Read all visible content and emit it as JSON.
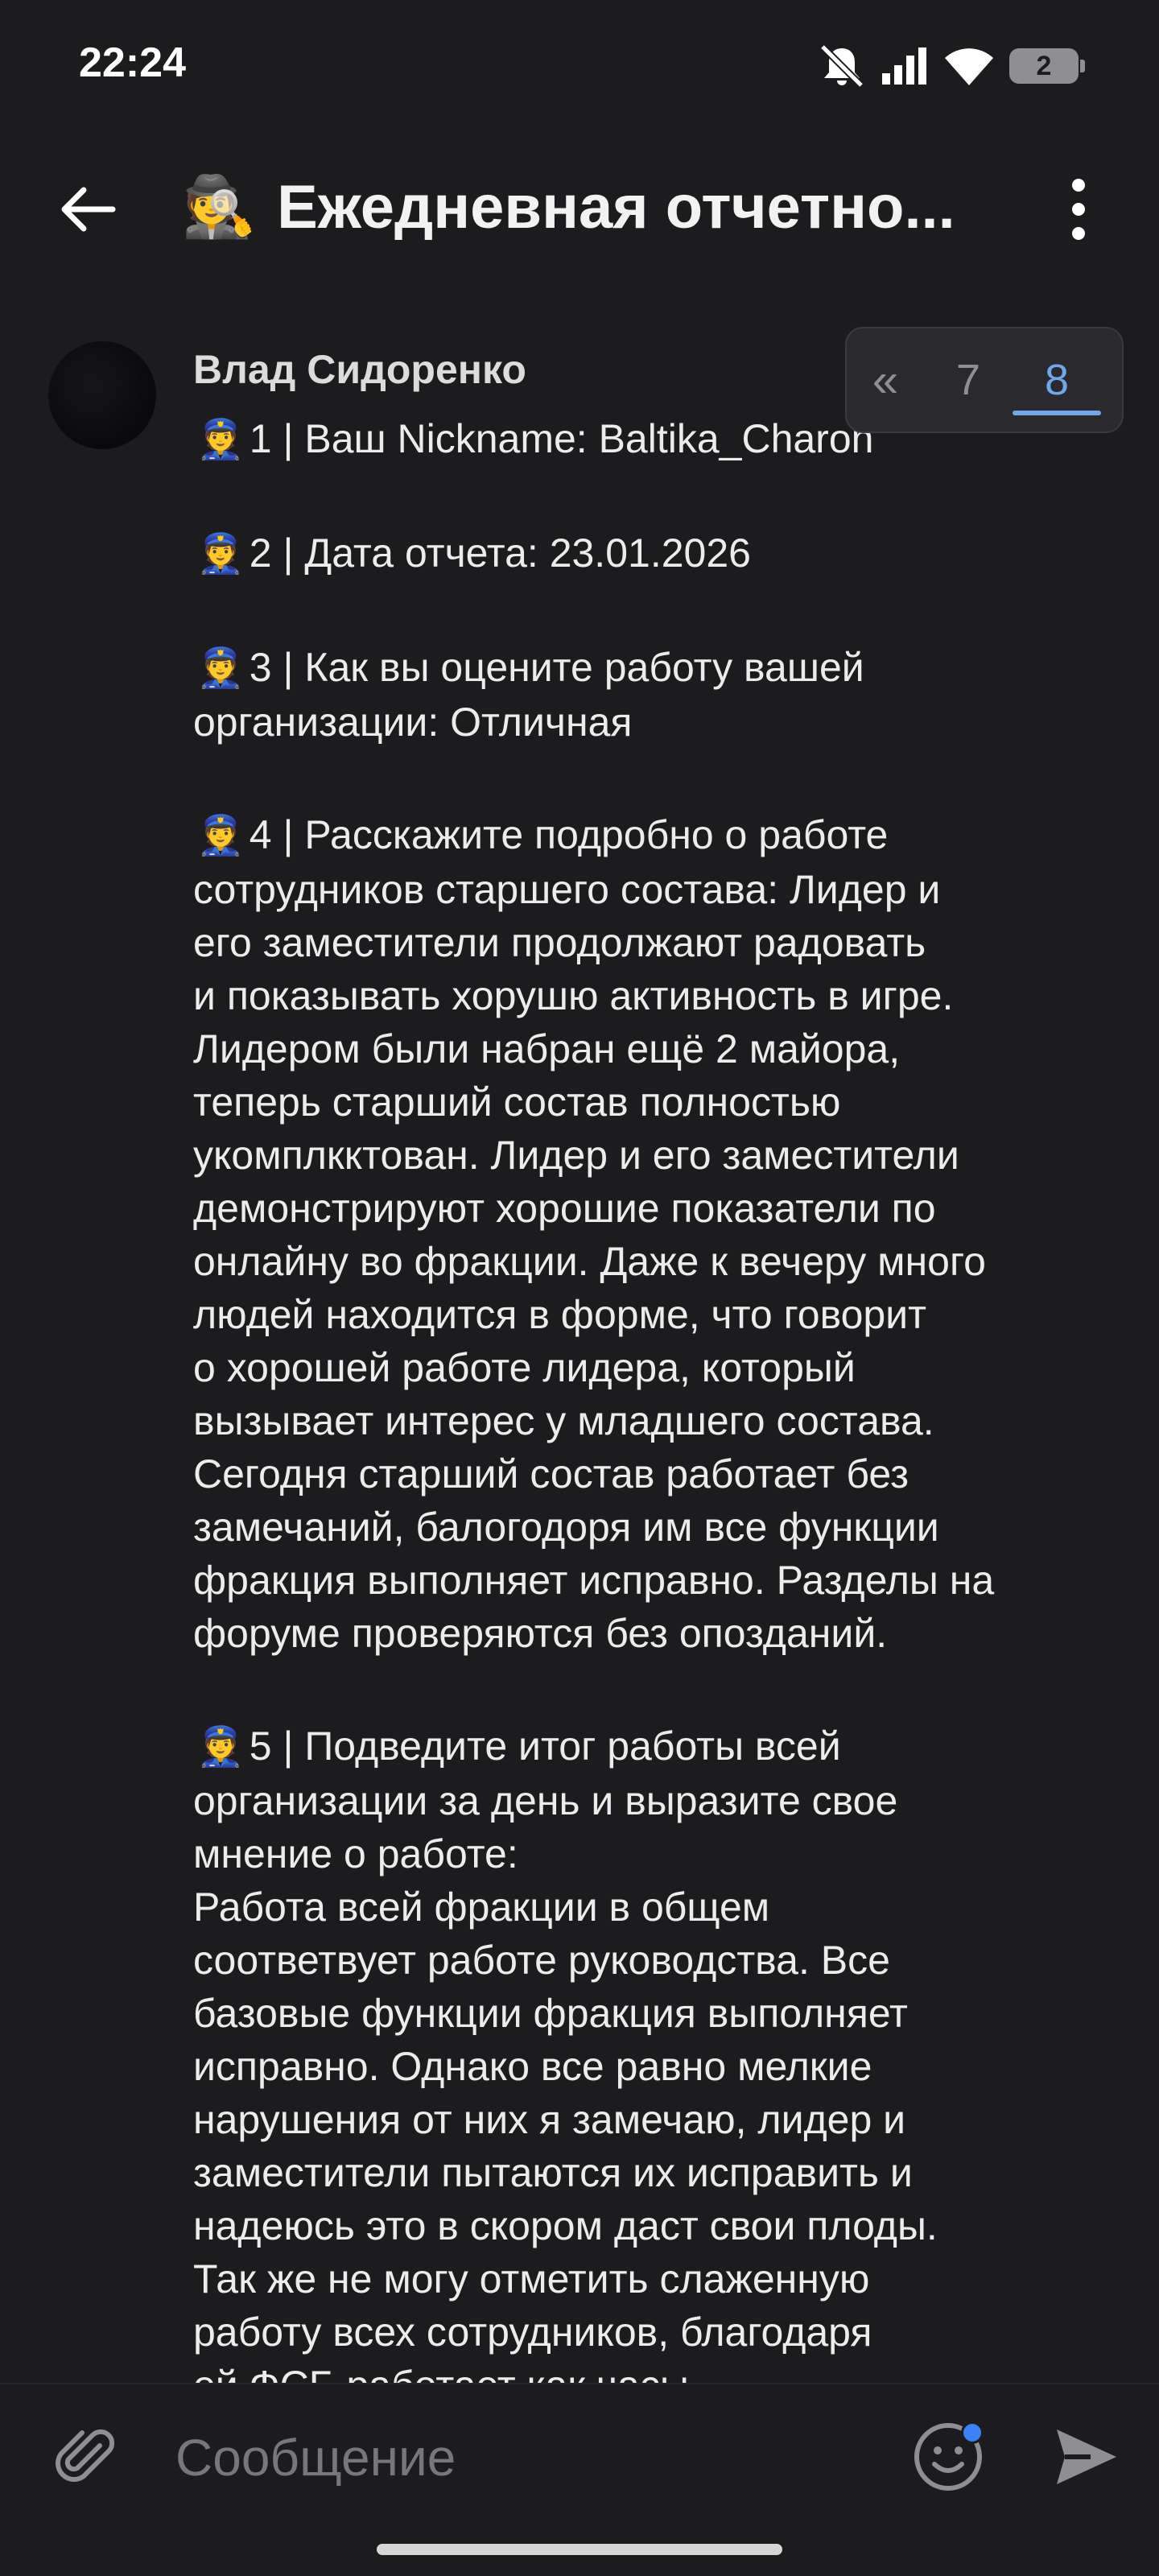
{
  "status_bar": {
    "time": "22:24",
    "battery_level": "2",
    "icons": [
      "mute-icon",
      "signal-icon",
      "wifi-icon",
      "battery-icon"
    ]
  },
  "header": {
    "title_emoji": "🕵️",
    "title": "Ежедневная отчетно..."
  },
  "message": {
    "author": "Влад Сидоренко",
    "emoji": "👮",
    "paragraphs": [
      [
        "1 | Ваш Nickname: Baltika_Charon"
      ],
      [
        "2 | Дата отчета: 23.01.2026"
      ],
      [
        "3 | Как вы оцените работу вашей",
        "организации: Отличная"
      ],
      [
        "4 | Расскажите подробно о работе",
        "сотрудников старшего состава:  Лидер и",
        "его заместители продолжают радовать",
        "и показывать хорушю активность в игре.",
        "Лидером были набран ещё 2 майора,",
        "теперь старший состав полностью",
        "укомплкктован. Лидер и его заместители",
        "демонстрируют хорошие показатели по",
        "онлайну во фракции. Даже к вечеру много",
        "людей находится в форме, что говорит",
        "о хорошей работе лидера, который",
        "вызывает интерес у младшего состава.",
        "Сегодня старший состав работает без",
        "замечаний, балогодоря им все функции",
        "фракция выполняет исправно. Разделы на",
        "форуме проверяются без опозданий."
      ],
      [
        "5 | Подведите итог работы всей",
        "организации за день и выразите свое",
        "мнение о работе:",
        "Работа всей фракции в общем",
        "соответвует работе руководства. Все",
        "базовые функции фракция выполняет",
        "исправно. Однако все равно мелкие",
        "нарушения от них я замечаю, лидер и",
        "заместители пытаются их исправить и",
        "надеюсь это в скором даст свои плоды.",
        "Так же не могу отметить слаженную",
        "работу всех сотрудников, благодаря",
        "ей ФСБ работает как часы"
      ]
    ]
  },
  "pager": {
    "prev": "«",
    "pages": [
      "7",
      "8"
    ],
    "active_page": "8",
    "accent_color": "#6fa8e8"
  },
  "input": {
    "placeholder": "Сообщение"
  },
  "colors": {
    "background": "#1c1c1e",
    "text": "#ececec",
    "muted": "#8e8e93",
    "notification_dot": "#3b82f6"
  }
}
